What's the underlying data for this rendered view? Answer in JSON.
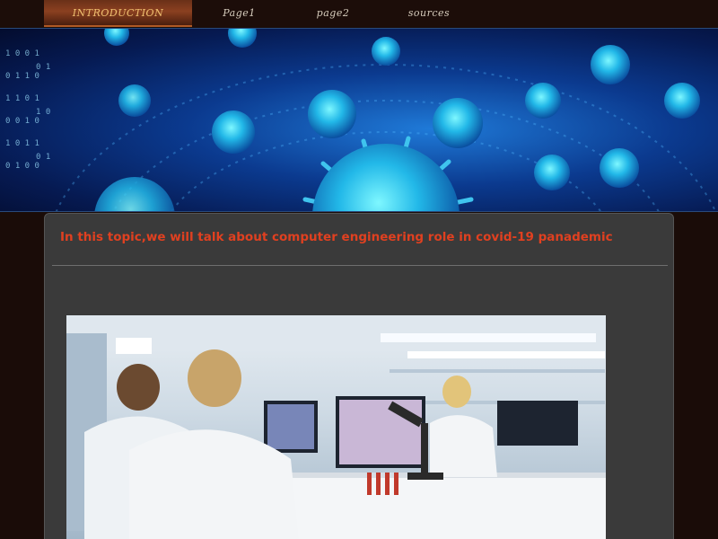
{
  "nav": {
    "items": [
      {
        "label": "INTRODUCTION",
        "active": true
      },
      {
        "label": "Page1",
        "active": false
      },
      {
        "label": "page2",
        "active": false
      },
      {
        "label": "sources",
        "active": false
      }
    ]
  },
  "banner": {
    "description_icon": "coronavirus-banner-image"
  },
  "main": {
    "title": "In this topic,we will talk about computer engineering role in covid-19 panademic",
    "image_icon": "laboratory-photo"
  },
  "colors": {
    "background": "#1a0c08",
    "nav_active": "#8b4020",
    "title_red": "#e04020",
    "panel": "#3a3a3a"
  }
}
